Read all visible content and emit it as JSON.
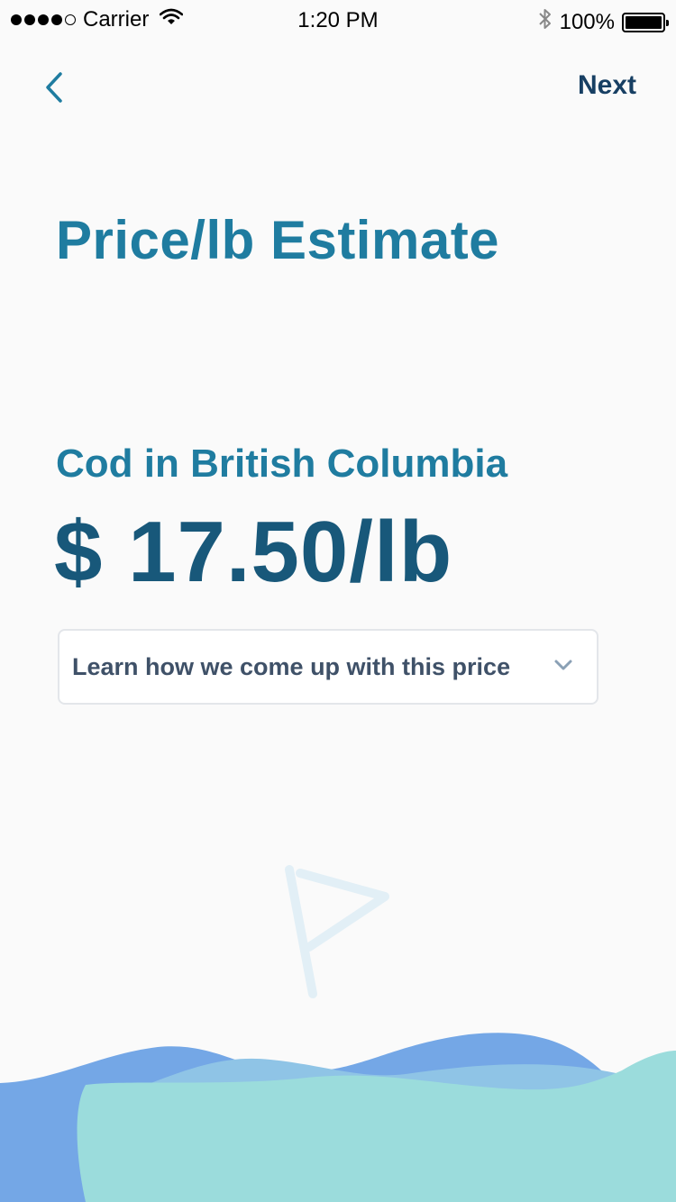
{
  "status_bar": {
    "carrier": "Carrier",
    "time": "1:20 PM",
    "battery": "100%",
    "signal_bars": 4,
    "signal_total": 5
  },
  "nav": {
    "back_icon": "chevron-left-icon",
    "next_label": "Next"
  },
  "page": {
    "title": "Price/lb Estimate",
    "location": "Cod in British Columbia",
    "price": "$ 17.50/lb"
  },
  "dropdown": {
    "label": "Learn how we come up with this price",
    "icon": "chevron-down-icon"
  },
  "decoration": {
    "flag_icon": "flag-icon",
    "wave_colors": [
      "#74a7e6",
      "#8fc4e6",
      "#9bdcdc"
    ]
  },
  "colors": {
    "title": "#1f7ca0",
    "price": "#18587a",
    "next": "#173f63",
    "background": "#fafafa"
  }
}
